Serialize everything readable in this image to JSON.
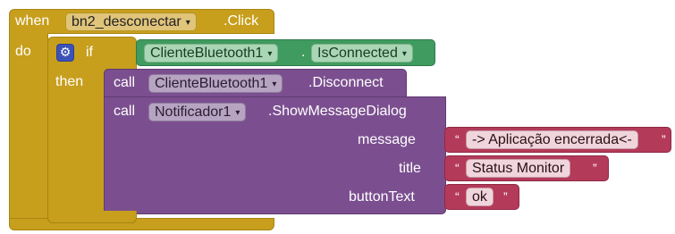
{
  "event": {
    "when_label": "when",
    "component": "bn2_desconectar",
    "event_name": ".Click",
    "do_label": "do"
  },
  "if_block": {
    "if_label": "if",
    "then_label": "then",
    "condition": {
      "component": "ClienteBluetooth1",
      "dot": ".",
      "property": "IsConnected"
    }
  },
  "call1": {
    "call_label": "call",
    "component": "ClienteBluetooth1",
    "method": ".Disconnect"
  },
  "call2": {
    "call_label": "call",
    "component": "Notificador1",
    "method": ".ShowMessageDialog",
    "params": [
      {
        "name": "message",
        "value": "-> Aplicação encerrada<-"
      },
      {
        "name": "title",
        "value": "Status Monitor"
      },
      {
        "name": "buttonText",
        "value": "ok"
      }
    ]
  },
  "quote_open": "“",
  "quote_close": "”",
  "dropdown_arrow": "▾",
  "icons": {
    "mutator": "gear-icon"
  },
  "colors": {
    "event_block": "#c79f1d",
    "control_block": "#c79f1d",
    "procedure_block": "#7b4f8f",
    "getter_block": "#3f9b5f",
    "text_block": "#b43a5a",
    "mutator_icon": "#3c52b8"
  }
}
